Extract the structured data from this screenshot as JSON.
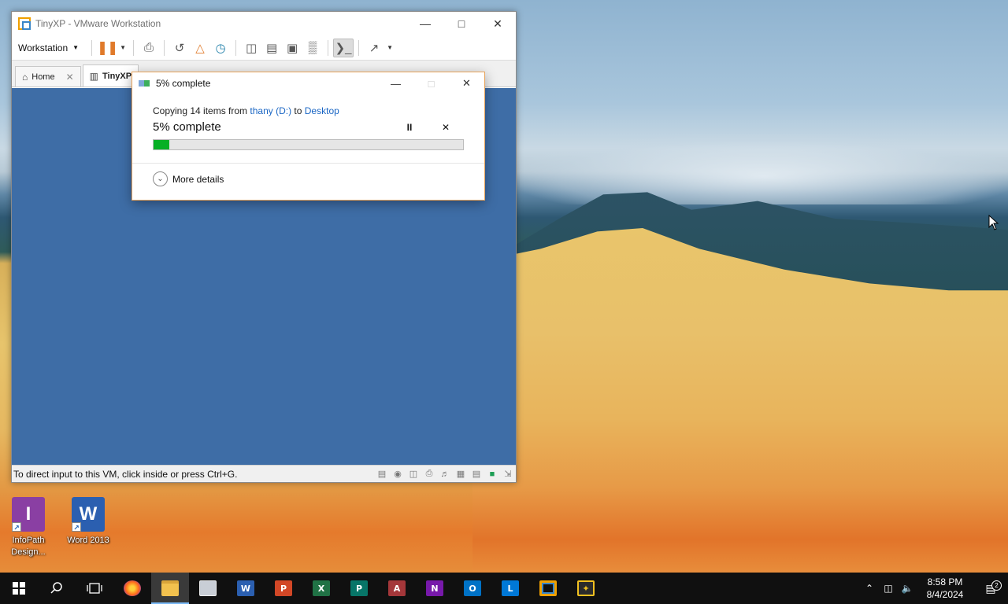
{
  "colors": {
    "taskbar_bg": "#101010",
    "vm_screen_bg": "#3e6da6",
    "progress_fill": "#06b025",
    "link_blue": "#1a66c4",
    "pause_orange": "#e07a2a"
  },
  "desktop": {
    "icons": [
      {
        "label": "InfoPath Design...",
        "icon": "infopath-designer-icon"
      },
      {
        "label": "Word 2013",
        "icon": "word-icon"
      }
    ]
  },
  "vmware": {
    "title": "TinyXP - VMware Workstation",
    "menu_label": "Workstation",
    "tabs": [
      {
        "label": "Home",
        "icon": "home-icon"
      },
      {
        "label": "TinyXP",
        "icon": "vm-icon"
      }
    ],
    "status_message": "To direct input to this VM, click inside or press Ctrl+G."
  },
  "copy_dialog": {
    "title": "5% complete",
    "copying_prefix": "Copying 14 items from ",
    "source": "thany (D:)",
    "to_word": " to ",
    "destination": "Desktop",
    "percent_text": "5% complete",
    "progress_fraction": 0.05,
    "pause_glyph": "II",
    "cancel_glyph": "✕",
    "more_details": "More details"
  },
  "taskbar": {
    "apps": [
      "firefox-icon",
      "file-explorer-icon",
      "remote-desktop-icon",
      "word-icon",
      "powerpoint-icon",
      "excel-icon",
      "publisher-icon",
      "access-icon",
      "onenote-icon",
      "outlook-icon",
      "lync-icon",
      "vmware-icon",
      "pcmanfm-icon"
    ],
    "time": "8:58 PM",
    "date": "8/4/2024",
    "notification_count": "2"
  }
}
